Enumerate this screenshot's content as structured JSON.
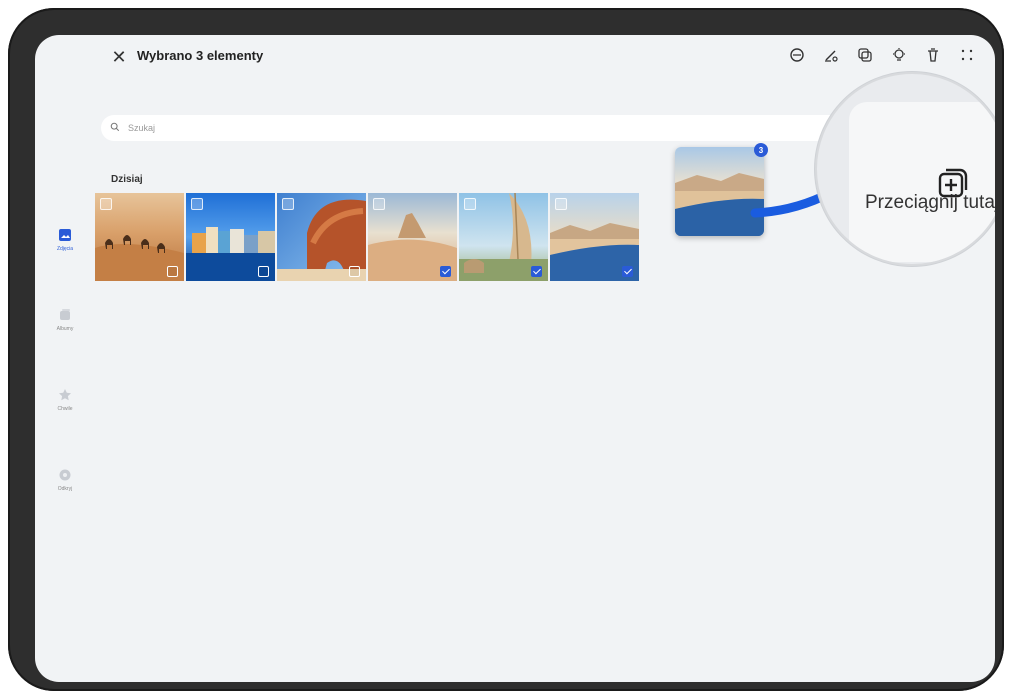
{
  "header": {
    "title": "Wybrano 3 elementy",
    "close_icon": "close-icon",
    "toolbar": [
      "share-icon",
      "edit-icon",
      "copy-icon",
      "lightbulb-icon",
      "trash-icon",
      "more-icon"
    ]
  },
  "search": {
    "placeholder": "Szukaj"
  },
  "sidebar": {
    "items": [
      {
        "label": "Zdjęcia",
        "icon": "photos-icon",
        "active": true
      },
      {
        "label": "Albumy",
        "icon": "albums-icon",
        "active": false
      },
      {
        "label": "Chwile",
        "icon": "star-icon",
        "active": false
      },
      {
        "label": "Odkryj",
        "icon": "discover-icon",
        "active": false
      }
    ]
  },
  "gallery": {
    "section": "Dzisiaj",
    "items": [
      {
        "name": "desert-camels",
        "selected": false
      },
      {
        "name": "blue-harbor",
        "selected": false
      },
      {
        "name": "red-rock-arch",
        "selected": false
      },
      {
        "name": "sand-desert",
        "selected": true
      },
      {
        "name": "sail-beach",
        "selected": true
      },
      {
        "name": "lake-mountains",
        "selected": true
      }
    ]
  },
  "drag": {
    "count": "3"
  },
  "drop_target": {
    "label": "Przeciągnij tutaj",
    "icon": "add-to-stack-icon"
  },
  "colors": {
    "accent": "#2a5bd7",
    "arrow": "#1a5ce0"
  }
}
